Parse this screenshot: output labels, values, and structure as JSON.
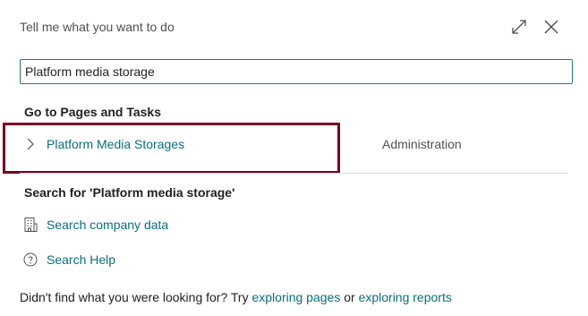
{
  "dialog": {
    "title": "Tell me what you want to do",
    "icons": {
      "expand": "expand-icon",
      "close": "close-icon"
    }
  },
  "search": {
    "value": "Platform media storage"
  },
  "goto": {
    "heading": "Go to Pages and Tasks",
    "results": [
      {
        "name": "Platform Media Storages",
        "category": "Administration",
        "icon": "chevron-right-icon"
      }
    ]
  },
  "search_for": {
    "heading": "Search for 'Platform media storage'",
    "actions": [
      {
        "label": "Search company data",
        "icon": "building-icon"
      },
      {
        "label": "Search Help",
        "icon": "help-icon"
      }
    ]
  },
  "footer": {
    "prefix": "Didn't find what you were looking for? Try ",
    "link_pages": "exploring pages",
    "middle": " or ",
    "link_reports": "exploring reports"
  },
  "colors": {
    "accent": "#0a6e7a",
    "input_border": "#1f7b7b",
    "highlight_border": "#7a0020",
    "divider": "#d8d8d8"
  }
}
